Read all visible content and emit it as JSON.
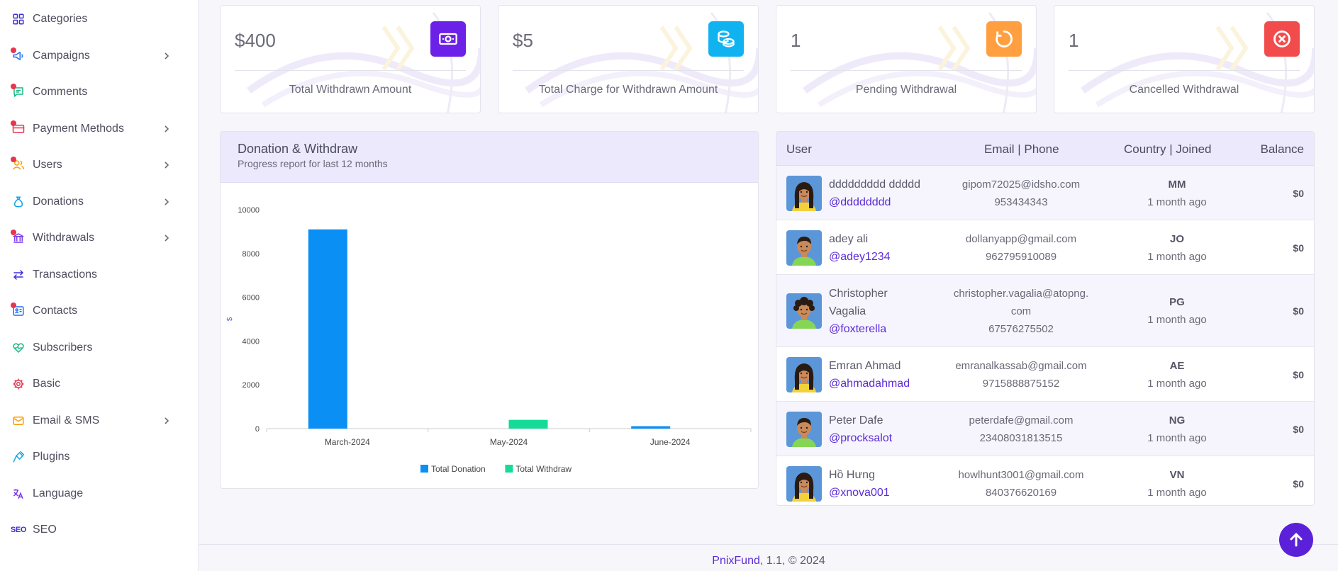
{
  "sidebar": {
    "items": [
      {
        "label": "Categories",
        "icon": "grid-icon",
        "has_chevron": false,
        "has_dot": false
      },
      {
        "label": "Campaigns",
        "icon": "megaphone-icon",
        "has_chevron": true,
        "has_dot": true
      },
      {
        "label": "Comments",
        "icon": "comment-icon",
        "has_chevron": false,
        "has_dot": true
      },
      {
        "label": "Payment Methods",
        "icon": "credit-card-icon",
        "has_chevron": true,
        "has_dot": true
      },
      {
        "label": "Users",
        "icon": "users-icon",
        "has_chevron": true,
        "has_dot": true
      },
      {
        "label": "Donations",
        "icon": "money-bag-icon",
        "has_chevron": true,
        "has_dot": false
      },
      {
        "label": "Withdrawals",
        "icon": "bank-icon",
        "has_chevron": true,
        "has_dot": true
      },
      {
        "label": "Transactions",
        "icon": "arrows-exchange-icon",
        "has_chevron": false,
        "has_dot": false
      },
      {
        "label": "Contacts",
        "icon": "contact-card-icon",
        "has_chevron": false,
        "has_dot": true
      },
      {
        "label": "Subscribers",
        "icon": "heart-pulse-icon",
        "has_chevron": false,
        "has_dot": false
      },
      {
        "label": "Basic",
        "icon": "gear-icon",
        "has_chevron": false,
        "has_dot": false
      },
      {
        "label": "Email & SMS",
        "icon": "envelope-icon",
        "has_chevron": true,
        "has_dot": false
      },
      {
        "label": "Plugins",
        "icon": "plug-icon",
        "has_chevron": false,
        "has_dot": false
      },
      {
        "label": "Language",
        "icon": "translate-icon",
        "has_chevron": false,
        "has_dot": false
      },
      {
        "label": "SEO",
        "icon": "seo-icon",
        "has_chevron": false,
        "has_dot": false
      }
    ]
  },
  "stats": [
    {
      "value": "$400",
      "label": "Total Withdrawn Amount",
      "icon": "money-bill-icon",
      "color": "#6b21e8"
    },
    {
      "value": "$5",
      "label": "Total Charge for Withdrawn Amount",
      "icon": "coins-stack-icon",
      "color": "#10b3f0"
    },
    {
      "value": "1",
      "label": "Pending Withdrawal",
      "icon": "loading-circle-icon",
      "color": "#ff9f40"
    },
    {
      "value": "1",
      "label": "Cancelled Withdrawal",
      "icon": "cancel-circle-icon",
      "color": "#f24b4b"
    }
  ],
  "chart_panel": {
    "title": "Donation & Withdraw",
    "subtitle": "Progress report for last 12 months"
  },
  "chart_data": {
    "type": "bar",
    "categories": [
      "March-2024",
      "May-2024",
      "June-2024"
    ],
    "series": [
      {
        "name": "Total Donation",
        "values": [
          9100,
          0,
          110
        ],
        "color": "#0a8ff5"
      },
      {
        "name": "Total Withdraw",
        "values": [
          0,
          400,
          0
        ],
        "color": "#14dc98"
      }
    ],
    "ylabel": "$",
    "ylim": [
      0,
      10000
    ],
    "yticks": [
      0,
      2000,
      4000,
      6000,
      8000,
      10000
    ],
    "legend": "bottom"
  },
  "users_table": {
    "headers": {
      "user": "User",
      "contact": "Email | Phone",
      "country": "Country | Joined",
      "balance": "Balance"
    },
    "rows": [
      {
        "name": "ddddddddd ddddd",
        "handle": "@dddddddd",
        "email": "gipom72025@idsho.com",
        "phone": "953434343",
        "country": "MM",
        "joined": "1 month ago",
        "balance": "$0",
        "avatar": "female"
      },
      {
        "name": "adey ali",
        "handle": "@adey1234",
        "email": "dollanyapp@gmail.com",
        "phone": "962795910089",
        "country": "JO",
        "joined": "1 month ago",
        "balance": "$0",
        "avatar": "male"
      },
      {
        "name": "Christopher Vagalia",
        "handle": "@foxterella",
        "email": "christopher.vagalia@atopng.",
        "email2": "com",
        "phone": "67576275502",
        "country": "PG",
        "joined": "1 month ago",
        "balance": "$0",
        "avatar": "curly"
      },
      {
        "name": "Emran Ahmad",
        "handle": "@ahmadahmad",
        "email": "emranalkassab@gmail.com",
        "phone": "9715888875152",
        "country": "AE",
        "joined": "1 month ago",
        "balance": "$0",
        "avatar": "female"
      },
      {
        "name": "Peter Dafe",
        "handle": "@procksalot",
        "email": "peterdafe@gmail.com",
        "phone": "23408031813515",
        "country": "NG",
        "joined": "1 month ago",
        "balance": "$0",
        "avatar": "male"
      },
      {
        "name": "Hồ Hưng",
        "handle": "@xnova001",
        "email": "howlhunt3001@gmail.com",
        "phone": "840376620169",
        "country": "VN",
        "joined": "1 month ago",
        "balance": "$0",
        "avatar": "female"
      }
    ]
  },
  "footer": {
    "brand": "PnixFund",
    "rest": ", 1.1, © 2024"
  }
}
